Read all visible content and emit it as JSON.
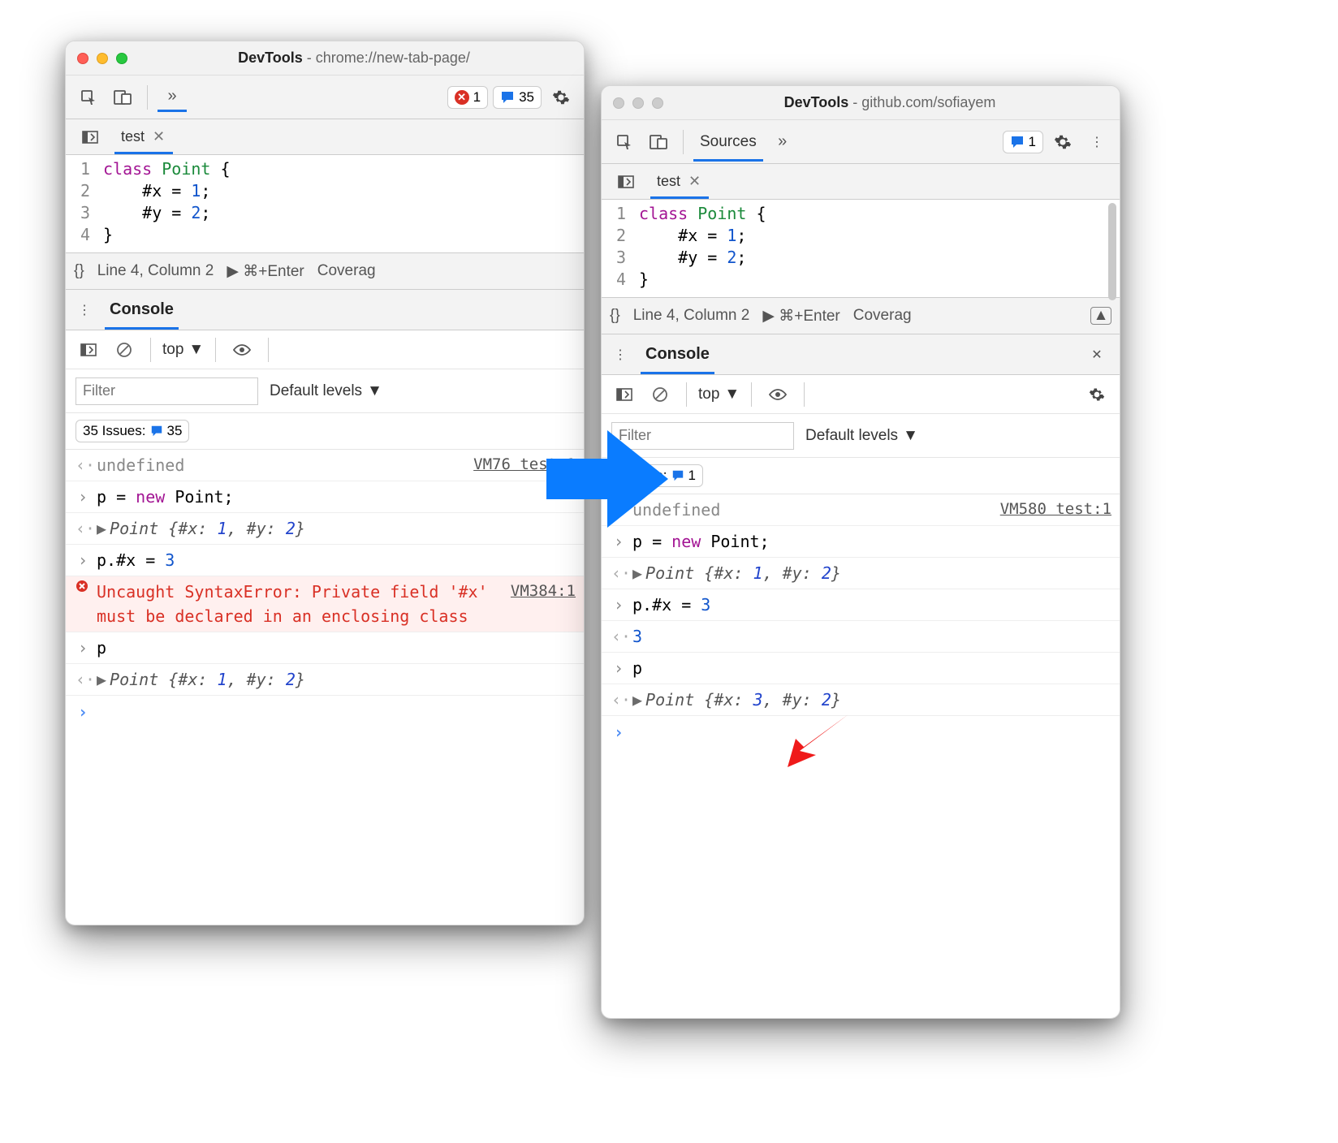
{
  "left": {
    "title_prefix": "DevTools",
    "title_url": "chrome://new-tab-page/",
    "errors": "1",
    "messages": "35",
    "file_tab": "test",
    "code": {
      "l1_kw": "class",
      "l1_cls": "Point",
      "l1_rest": " {",
      "l2_pre": "    #x = ",
      "l2_num": "1",
      "l2_post": ";",
      "l3_pre": "    #y = ",
      "l3_num": "2",
      "l3_post": ";",
      "l4": "}"
    },
    "status": {
      "braces": "{}",
      "pos": "Line 4, Column 2",
      "run": "⌘+Enter",
      "cov": "Coverag"
    },
    "console_label": "Console",
    "ctx": "top",
    "filter_placeholder": "Filter",
    "levels": "Default levels",
    "issues_label": "35 Issues:",
    "issues_count": "35",
    "log": {
      "r0": {
        "text": "undefined",
        "src": "VM76 test:1"
      },
      "r1_a": "p = ",
      "r1_b": "new",
      "r1_c": " Point;",
      "r2_a": "Point ",
      "r2_b": "{#x: ",
      "r2_c": "1",
      "r2_d": ", #y: ",
      "r2_e": "2",
      "r2_f": "}",
      "r3_a": "p.#x = ",
      "r3_b": "3",
      "r4_text": "Uncaught SyntaxError: Private field '#x' must be declared in an enclosing class",
      "r4_src": "VM384:1",
      "r5": "p",
      "r6_a": "Point ",
      "r6_b": "{#x: ",
      "r6_c": "1",
      "r6_d": ", #y: ",
      "r6_e": "2",
      "r6_f": "}"
    }
  },
  "right": {
    "title_prefix": "DevTools",
    "title_url": "github.com/sofiayem",
    "tab": "Sources",
    "messages": "1",
    "file_tab": "test",
    "code": {
      "l1_kw": "class",
      "l1_cls": "Point",
      "l1_rest": " {",
      "l2_pre": "    #x = ",
      "l2_num": "1",
      "l2_post": ";",
      "l3_pre": "    #y = ",
      "l3_num": "2",
      "l3_post": ";",
      "l4": "}"
    },
    "status": {
      "braces": "{}",
      "pos": "Line 4, Column 2",
      "run": "⌘+Enter",
      "cov": "Coverag"
    },
    "console_label": "Console",
    "ctx": "top",
    "filter_placeholder": "Filter",
    "levels": "Default levels",
    "issues_label": "1 Issue:",
    "issues_count": "1",
    "log": {
      "r0": {
        "text": "undefined",
        "src": "VM580 test:1"
      },
      "r1_a": "p = ",
      "r1_b": "new",
      "r1_c": " Point;",
      "r2_a": "Point ",
      "r2_b": "{#x: ",
      "r2_c": "1",
      "r2_d": ", #y: ",
      "r2_e": "2",
      "r2_f": "}",
      "r3_a": "p.#x = ",
      "r3_b": "3",
      "r4": "3",
      "r5": "p",
      "r6_a": "Point ",
      "r6_b": "{#x: ",
      "r6_c": "3",
      "r6_d": ", #y: ",
      "r6_e": "2",
      "r6_f": "}"
    }
  }
}
